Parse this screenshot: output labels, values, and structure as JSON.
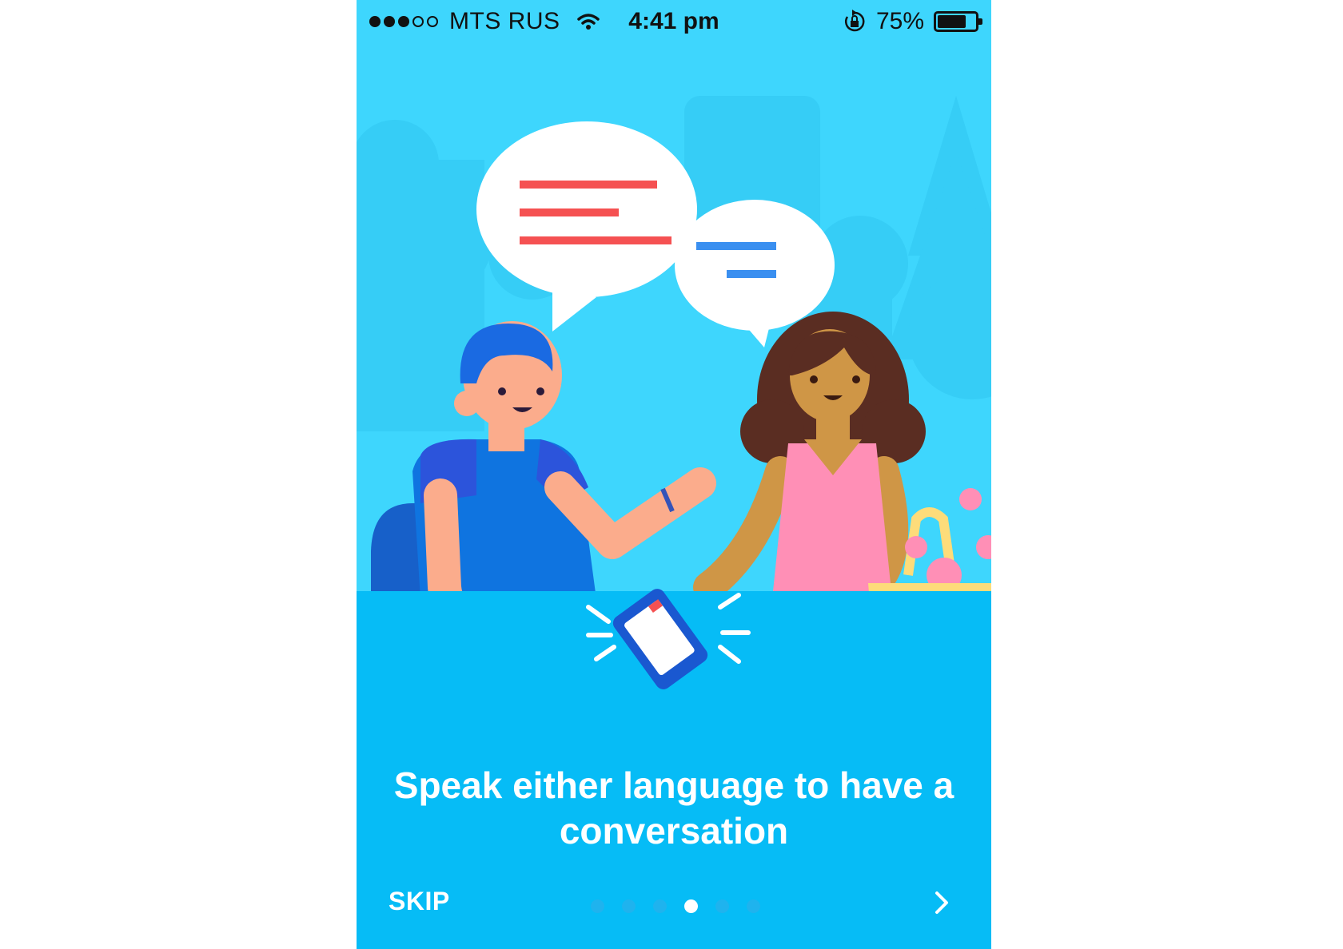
{
  "status_bar": {
    "carrier": "MTS RUS",
    "time": "4:41 pm",
    "battery": "75%",
    "signal_bars_filled": 3,
    "signal_bars_total": 5,
    "battery_level": 0.75
  },
  "onboarding": {
    "caption_line1": "Speak either language to have a",
    "caption_line2": "conversation",
    "skip_label": "SKIP",
    "page_count": 6,
    "current_page": 4
  },
  "colors": {
    "background": "#3ed6fd",
    "table": "#06bcf6",
    "speech_red": "#f55152",
    "speech_blue": "#3a8ff0"
  },
  "icons": [
    "wifi-icon",
    "rotation-lock-icon",
    "battery-icon",
    "chevron-right-icon"
  ]
}
